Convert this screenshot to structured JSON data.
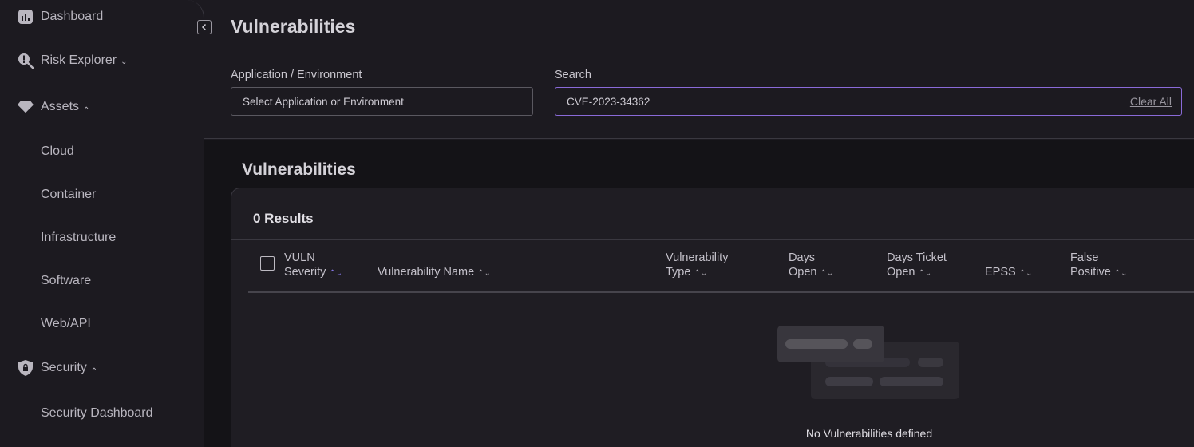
{
  "sidebar": {
    "items": [
      {
        "label": "Dashboard"
      },
      {
        "label": "Risk Explorer",
        "chevron": "down"
      },
      {
        "label": "Assets",
        "chevron": "up"
      },
      {
        "label": "Cloud"
      },
      {
        "label": "Container"
      },
      {
        "label": "Infrastructure"
      },
      {
        "label": "Software"
      },
      {
        "label": "Web/API"
      },
      {
        "label": "Security",
        "chevron": "up"
      },
      {
        "label": "Security Dashboard"
      }
    ],
    "chevron_down": "⌄",
    "chevron_up": "⌃"
  },
  "header": {
    "title": "Vulnerabilities",
    "app_env_label": "Application / Environment",
    "app_env_placeholder": "Select Application or Environment",
    "search_label": "Search",
    "search_value": "CVE-2023-34362",
    "clear_all": "Clear All"
  },
  "table": {
    "section_title": "Vulnerabilities",
    "results": "0 Results",
    "columns": [
      {
        "line1": "VULN",
        "line2": "Severity"
      },
      {
        "line1": "",
        "line2": "Vulnerability Name"
      },
      {
        "line1": "Vulnerability",
        "line2": "Type"
      },
      {
        "line1": "Days",
        "line2": "Open"
      },
      {
        "line1": "Days Ticket",
        "line2": "Open"
      },
      {
        "line1": "",
        "line2": "EPSS"
      },
      {
        "line1": "False",
        "line2": "Positive"
      }
    ],
    "empty_message": "No Vulnerabilities defined"
  },
  "colors": {
    "background": "#1c1a20",
    "accent": "#8b7cf0",
    "focus_border": "#8a6ad8"
  },
  "icons": [
    "bar-chart-icon",
    "risk-search-icon",
    "gem-icon",
    "shield-lock-icon",
    "chevron-left-icon",
    "sort-icon"
  ]
}
